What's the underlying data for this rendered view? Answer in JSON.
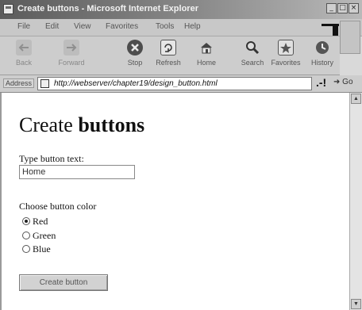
{
  "window": {
    "title": "Create buttons - Microsoft Internet Explorer",
    "controls": [
      "_",
      "□",
      "×"
    ]
  },
  "menu": [
    "File",
    "Edit",
    "View",
    "Favorites",
    "Tools",
    "Help"
  ],
  "toolbar": [
    {
      "label": "Back",
      "icon": "back-arrow-icon",
      "enabled": false
    },
    {
      "label": "Forward",
      "icon": "forward-arrow-icon",
      "enabled": false
    },
    {
      "label": "Stop",
      "icon": "stop-icon",
      "enabled": true
    },
    {
      "label": "Refresh",
      "icon": "refresh-icon",
      "enabled": true
    },
    {
      "label": "Home",
      "icon": "home-icon",
      "enabled": true
    },
    {
      "label": "Search",
      "icon": "search-icon",
      "enabled": true
    },
    {
      "label": "Favorites",
      "icon": "favorites-icon",
      "enabled": true
    },
    {
      "label": "History",
      "icon": "history-icon",
      "enabled": true
    }
  ],
  "address": {
    "label": "Address",
    "url": "http://webserver/chapter19/design_button.html",
    "go": "Go"
  },
  "page": {
    "title_plain": "Create",
    "title_bold": "buttons",
    "text_label": "Type button text:",
    "text_value": "Home",
    "color_label": "Choose button color",
    "colors": [
      {
        "label": "Red",
        "selected": true
      },
      {
        "label": "Green",
        "selected": false
      },
      {
        "label": "Blue",
        "selected": false
      }
    ],
    "submit_label": "Create button"
  }
}
